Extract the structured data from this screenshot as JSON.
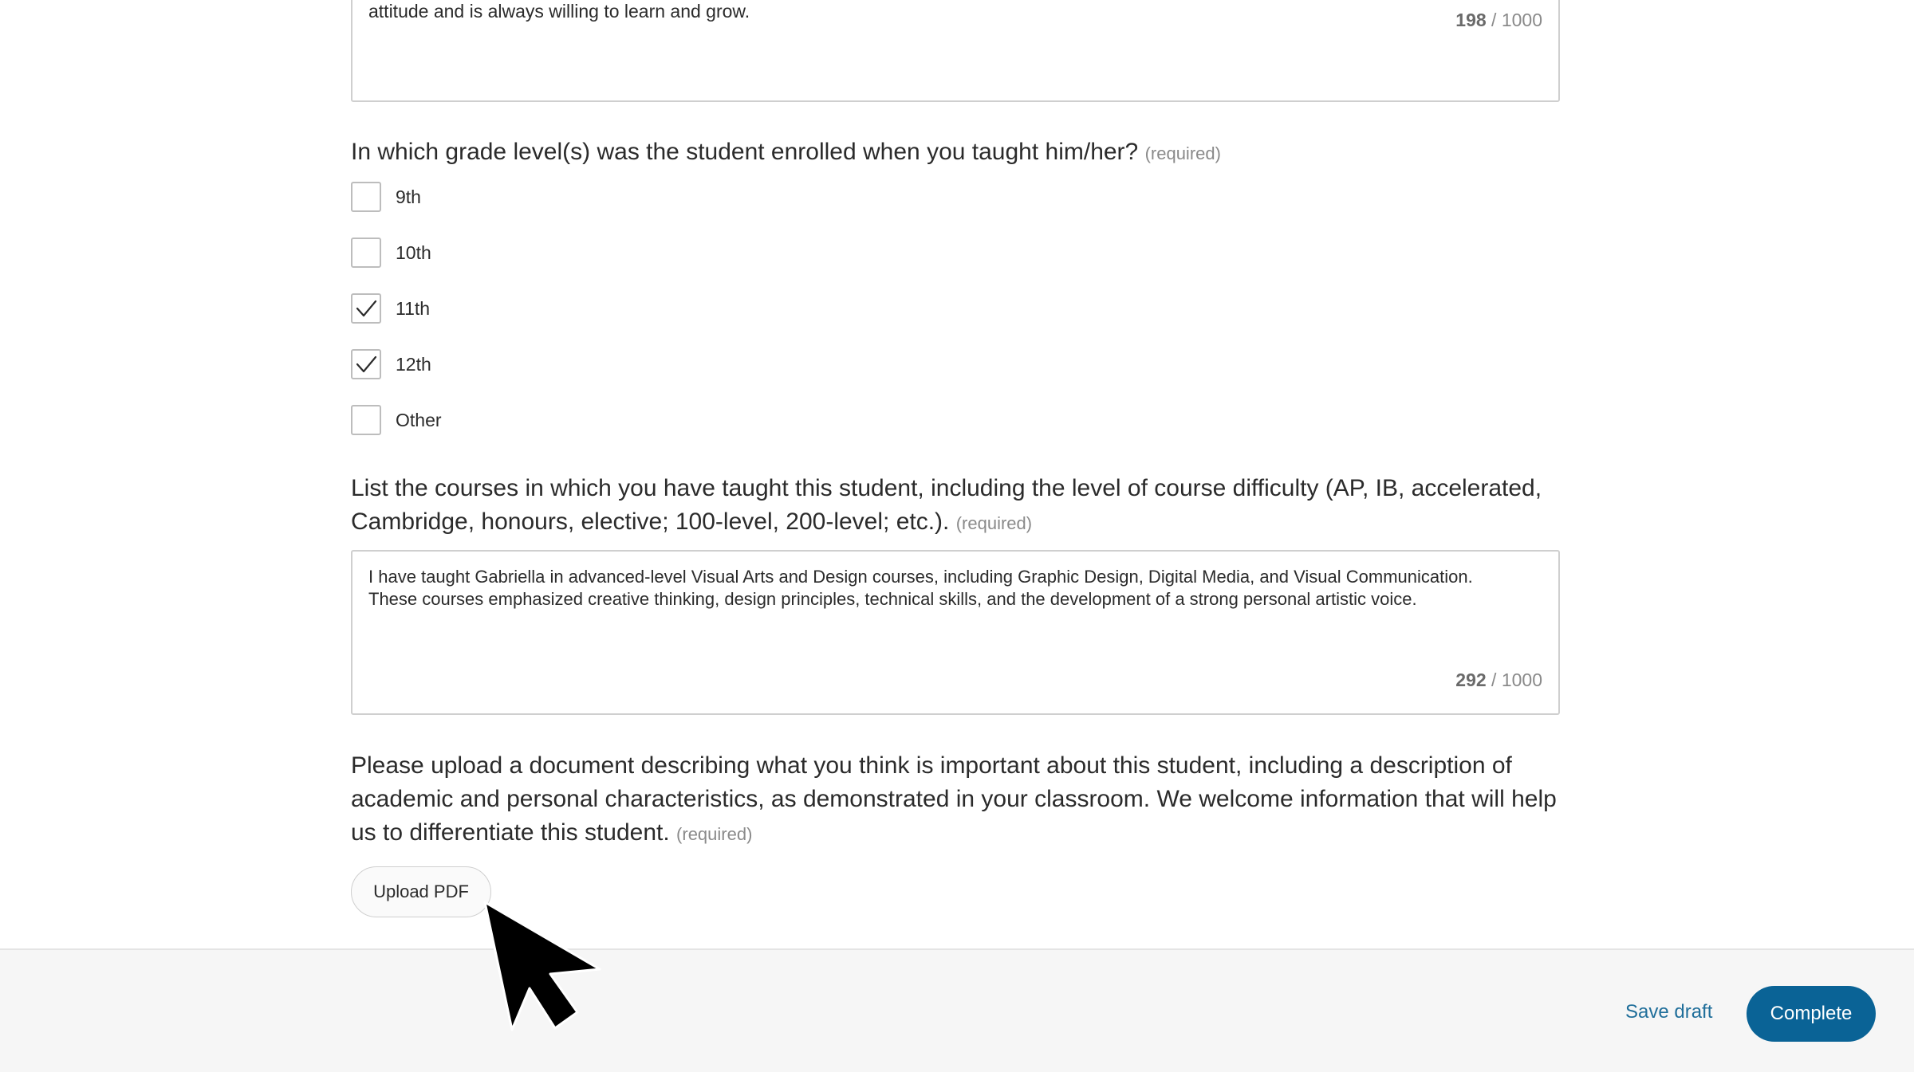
{
  "previous_answer": {
    "text": "attitude and is always willing to learn and grow.",
    "count": "198",
    "max": "/ 1000"
  },
  "grade_question": {
    "text": "In which grade level(s) was the student enrolled when you taught him/her?",
    "required": "(required)",
    "options": [
      {
        "label": "9th",
        "checked": false
      },
      {
        "label": "10th",
        "checked": false
      },
      {
        "label": "11th",
        "checked": true
      },
      {
        "label": "12th",
        "checked": true
      },
      {
        "label": "Other",
        "checked": false
      }
    ]
  },
  "courses_question": {
    "text": "List the courses in which you have taught this student, including the level of course difficulty (AP, IB, accelerated, Cambridge, honours, elective; 100-level, 200-level; etc.).",
    "required": "(required)",
    "answer": "I have taught Gabriella in advanced-level Visual Arts and Design courses, including Graphic Design, Digital Media, and Visual Communication. These courses emphasized creative thinking, design principles, technical skills, and the development of a strong personal artistic voice.",
    "count": "292",
    "max": "/ 1000"
  },
  "upload_question": {
    "text": "Please upload a document describing what you think is important about this student, including a description of academic and personal characteristics, as demonstrated in your classroom. We welcome information that will help us to differentiate this student.",
    "required": "(required)",
    "button_label": "Upload PDF"
  },
  "footer": {
    "save_draft_label": "Save draft",
    "complete_label": "Complete"
  },
  "icons": {
    "checkmark": "checkmark-icon",
    "cursor": "mouse-pointer-icon"
  },
  "colors": {
    "primary": "#0a6396",
    "link": "#1f6e9a",
    "footer_bg": "#f6f6f6"
  }
}
